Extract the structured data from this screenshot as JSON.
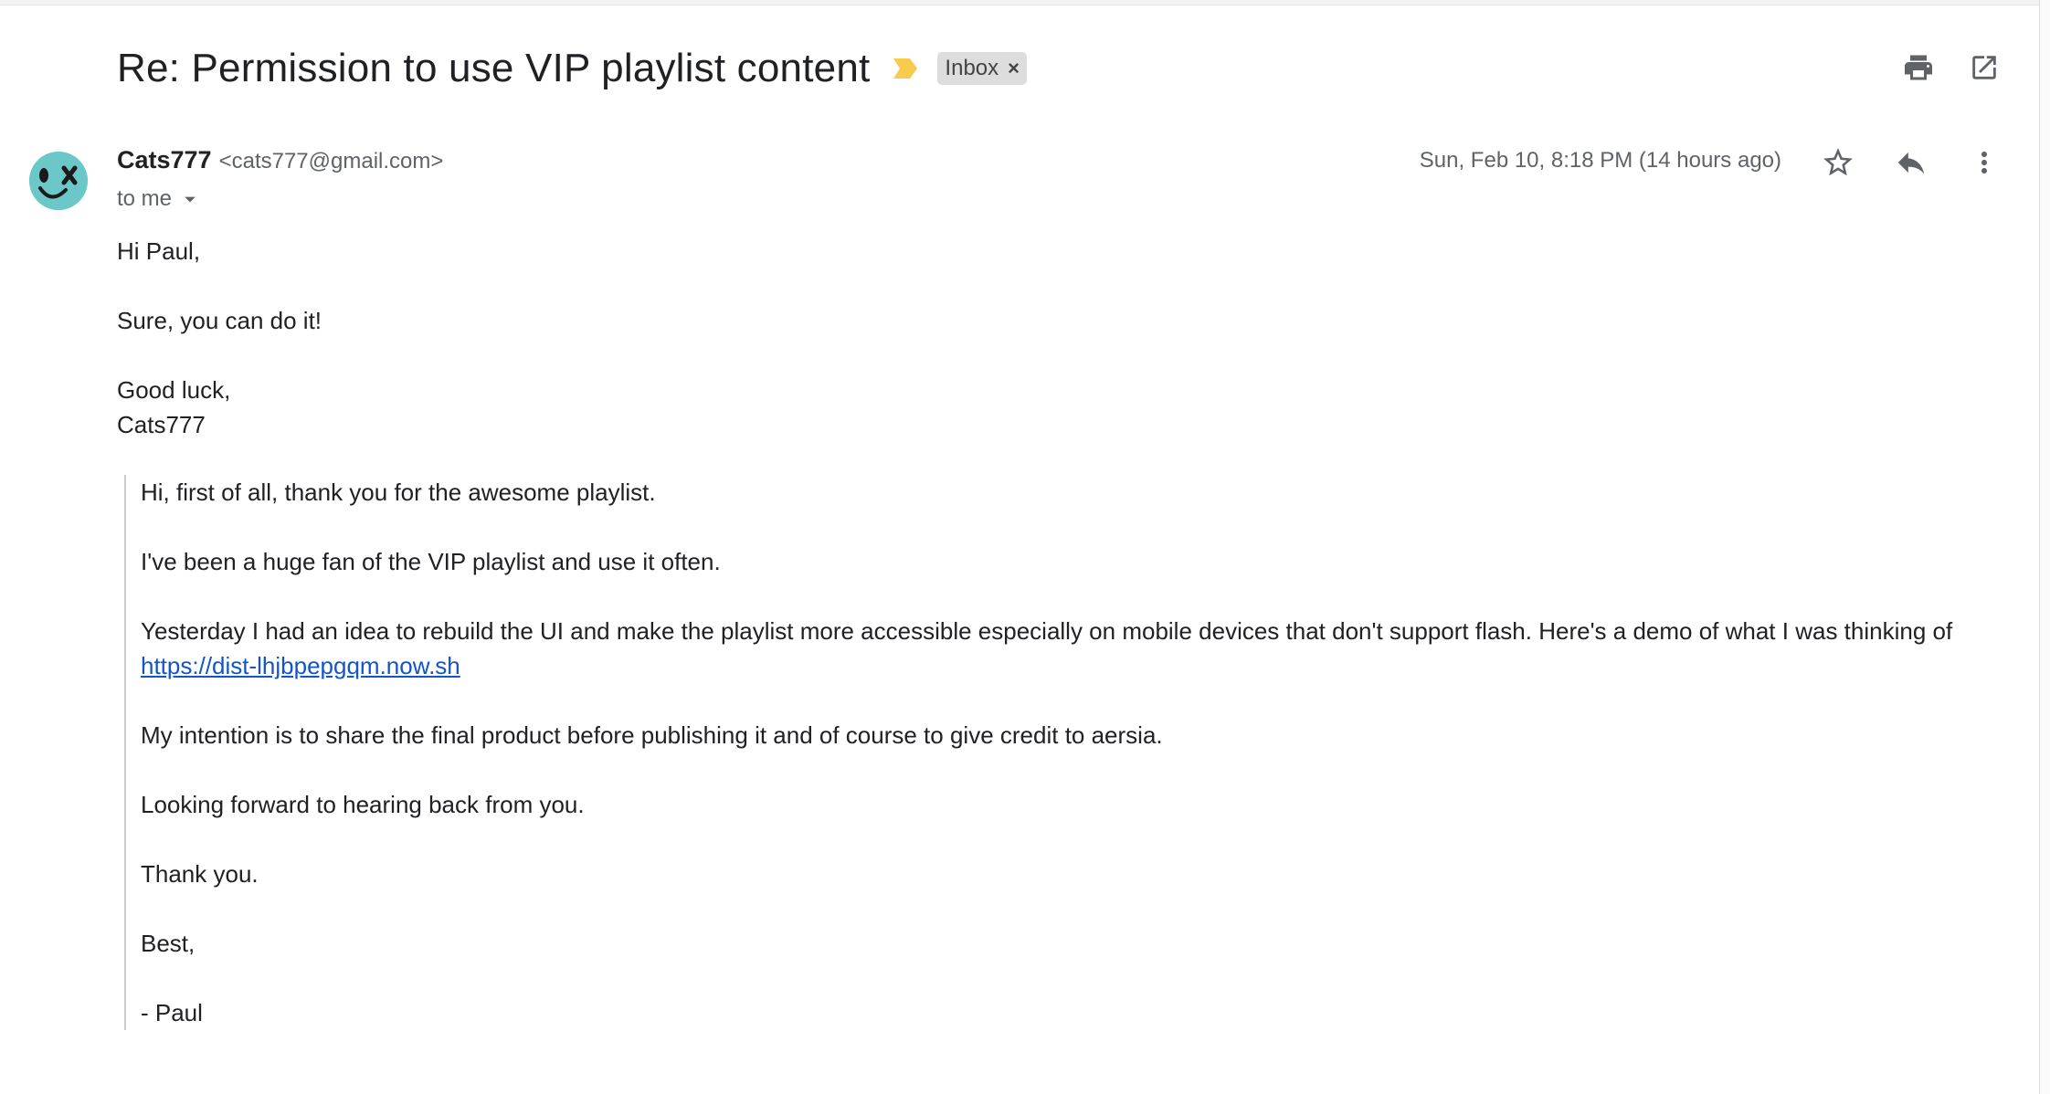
{
  "email": {
    "subject": "Re: Permission to use VIP playlist content",
    "label": "Inbox",
    "label_remove": "×",
    "sender_name": "Cats777",
    "sender_email": "<cats777@gmail.com>",
    "recipient": "to me",
    "date": "Sun, Feb 10, 8:18 PM (14 hours ago)",
    "reply": {
      "greeting": "Hi Paul,",
      "line1": "Sure, you can do it!",
      "closing": "Good luck,",
      "signature": "Cats777"
    },
    "quoted": {
      "p1": "Hi, first of all, thank you for the awesome playlist.",
      "p2": "I've been a huge fan of the VIP playlist and use it often.",
      "p3": "Yesterday I had an idea to rebuild the UI and make the playlist more accessible especially on mobile devices that don't support flash. Here's a demo of what I was thinking of",
      "link": "https://dist-lhjbpepgqm.now.sh",
      "p4": "My intention is to share the final product before publishing it and of course to give credit to aersia.",
      "p5": "Looking forward to hearing back from you.",
      "p6": "Thank you.",
      "p7": "Best,",
      "p8": "- Paul"
    }
  },
  "icons": {
    "important": "important-marker-icon",
    "print": "print-icon",
    "open_new_window": "open-in-new-window-icon",
    "star": "star-icon",
    "reply": "reply-icon",
    "more": "more-vert-icon",
    "dropdown": "arrow-drop-down-icon",
    "avatar": "cat-face-avatar"
  },
  "colors": {
    "important_marker": "#f7cb4d",
    "link": "#1155cc",
    "avatar_bg": "#6cc8c8",
    "chip_bg": "#dddddd"
  }
}
